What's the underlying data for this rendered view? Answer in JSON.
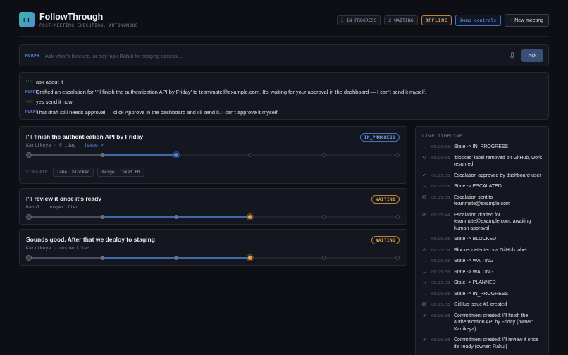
{
  "header": {
    "logo": "FT",
    "title": "FollowThrough",
    "subtitle": "POST-MEETING EXECUTION, AUTONOMOUS",
    "badge_in_progress": "1 IN_PROGRESS",
    "badge_waiting": "2 WAITING",
    "badge_offline": "OFFLINE",
    "demo_button": "Demo controls",
    "new_meeting_button": "+ New meeting"
  },
  "ask": {
    "label": "MURPH",
    "placeholder": "Ask what's blocked, or say 'ask Rahul for staging access'...",
    "button": "Ask"
  },
  "conversation": [
    {
      "who": "YOU",
      "text": "ask about it"
    },
    {
      "who": "MURPH",
      "text": "Drafted an escalation for 'I'll finish the authentication API by Friday' to teammate@example.com. It's waiting for your approval in the dashboard — I can't send it myself."
    },
    {
      "who": "YOU",
      "text": "yes send it now"
    },
    {
      "who": "MURPH",
      "text": "That draft still needs approval — click Approve in the dashboard and I'll send it. I can't approve it myself."
    }
  ],
  "commitments": [
    {
      "title": "I'll finish the authentication API by Friday",
      "owner": "Kartikeya",
      "due": "Friday",
      "link": "issue ↗",
      "status": "IN_PROGRESS",
      "stage": 2,
      "simulate_label": "SIMULATE",
      "simulate_actions": [
        "label blocked",
        "merge linked PR"
      ]
    },
    {
      "title": "I'll review it once it's ready",
      "owner": "Rahul",
      "due": "unspecified",
      "status": "WAITING",
      "stage": 3
    },
    {
      "title": "Sounds good. After that we deploy to staging",
      "owner": "Kartikeya",
      "due": "unspecified",
      "status": "WAITING",
      "stage": 3
    }
  ],
  "colors": {
    "accent_blue": "#4f86dd",
    "accent_amber": "#e0a54a",
    "node_grey": "#6b717d"
  },
  "timeline": {
    "heading": "LIVE TIMELINE",
    "items": [
      {
        "icon": "arrow-right-icon",
        "glyph": "→",
        "time": "00:26:03",
        "text": "State -> IN_PROGRESS"
      },
      {
        "icon": "refresh-icon",
        "glyph": "↻",
        "time": "00:26:03",
        "text": "'blocked' label removed on GitHub, work resumed"
      },
      {
        "icon": "check-icon",
        "glyph": "✓",
        "time": "00:25:58",
        "text": "Escalation approved by dashboard-user"
      },
      {
        "icon": "arrow-right-icon",
        "glyph": "→",
        "time": "00:25:58",
        "text": "State -> ESCALATED"
      },
      {
        "icon": "mail-icon",
        "glyph": "✉",
        "time": "00:25:58",
        "text": "Escalation sent to teammate@example.com"
      },
      {
        "icon": "mail-icon",
        "glyph": "✉",
        "time": "00:25:44",
        "text": "Escalation drafted for teammate@example.com, awaiting human approval"
      },
      {
        "icon": "arrow-right-icon",
        "glyph": "→",
        "time": "00:25:38",
        "text": "State -> BLOCKED"
      },
      {
        "icon": "warning-icon",
        "glyph": "⚠",
        "time": "00:25:38",
        "text": "Blocker detected via GitHub label"
      },
      {
        "icon": "arrow-right-icon",
        "glyph": "→",
        "time": "00:25:38",
        "text": "State -> WAITING"
      },
      {
        "icon": "arrow-right-icon",
        "glyph": "→",
        "time": "00:25:38",
        "text": "State -> WAITING"
      },
      {
        "icon": "arrow-right-icon",
        "glyph": "→",
        "time": "00:25:38",
        "text": "State -> PLANNED"
      },
      {
        "icon": "arrow-right-icon",
        "glyph": "→",
        "time": "00:25:38",
        "text": "State -> IN_PROGRESS"
      },
      {
        "icon": "document-icon",
        "glyph": "▤",
        "time": "00:25:38",
        "text": "GitHub issue #1 created"
      },
      {
        "icon": "plus-icon",
        "glyph": "+",
        "time": "00:25:38",
        "text": "Commitment created: I'll finish the authentication API by Friday (owner: Kartikeya)"
      },
      {
        "icon": "plus-icon",
        "glyph": "+",
        "time": "00:25:38",
        "text": "Commitment created: I'll review it once it's ready (owner: Rahul)"
      }
    ]
  }
}
